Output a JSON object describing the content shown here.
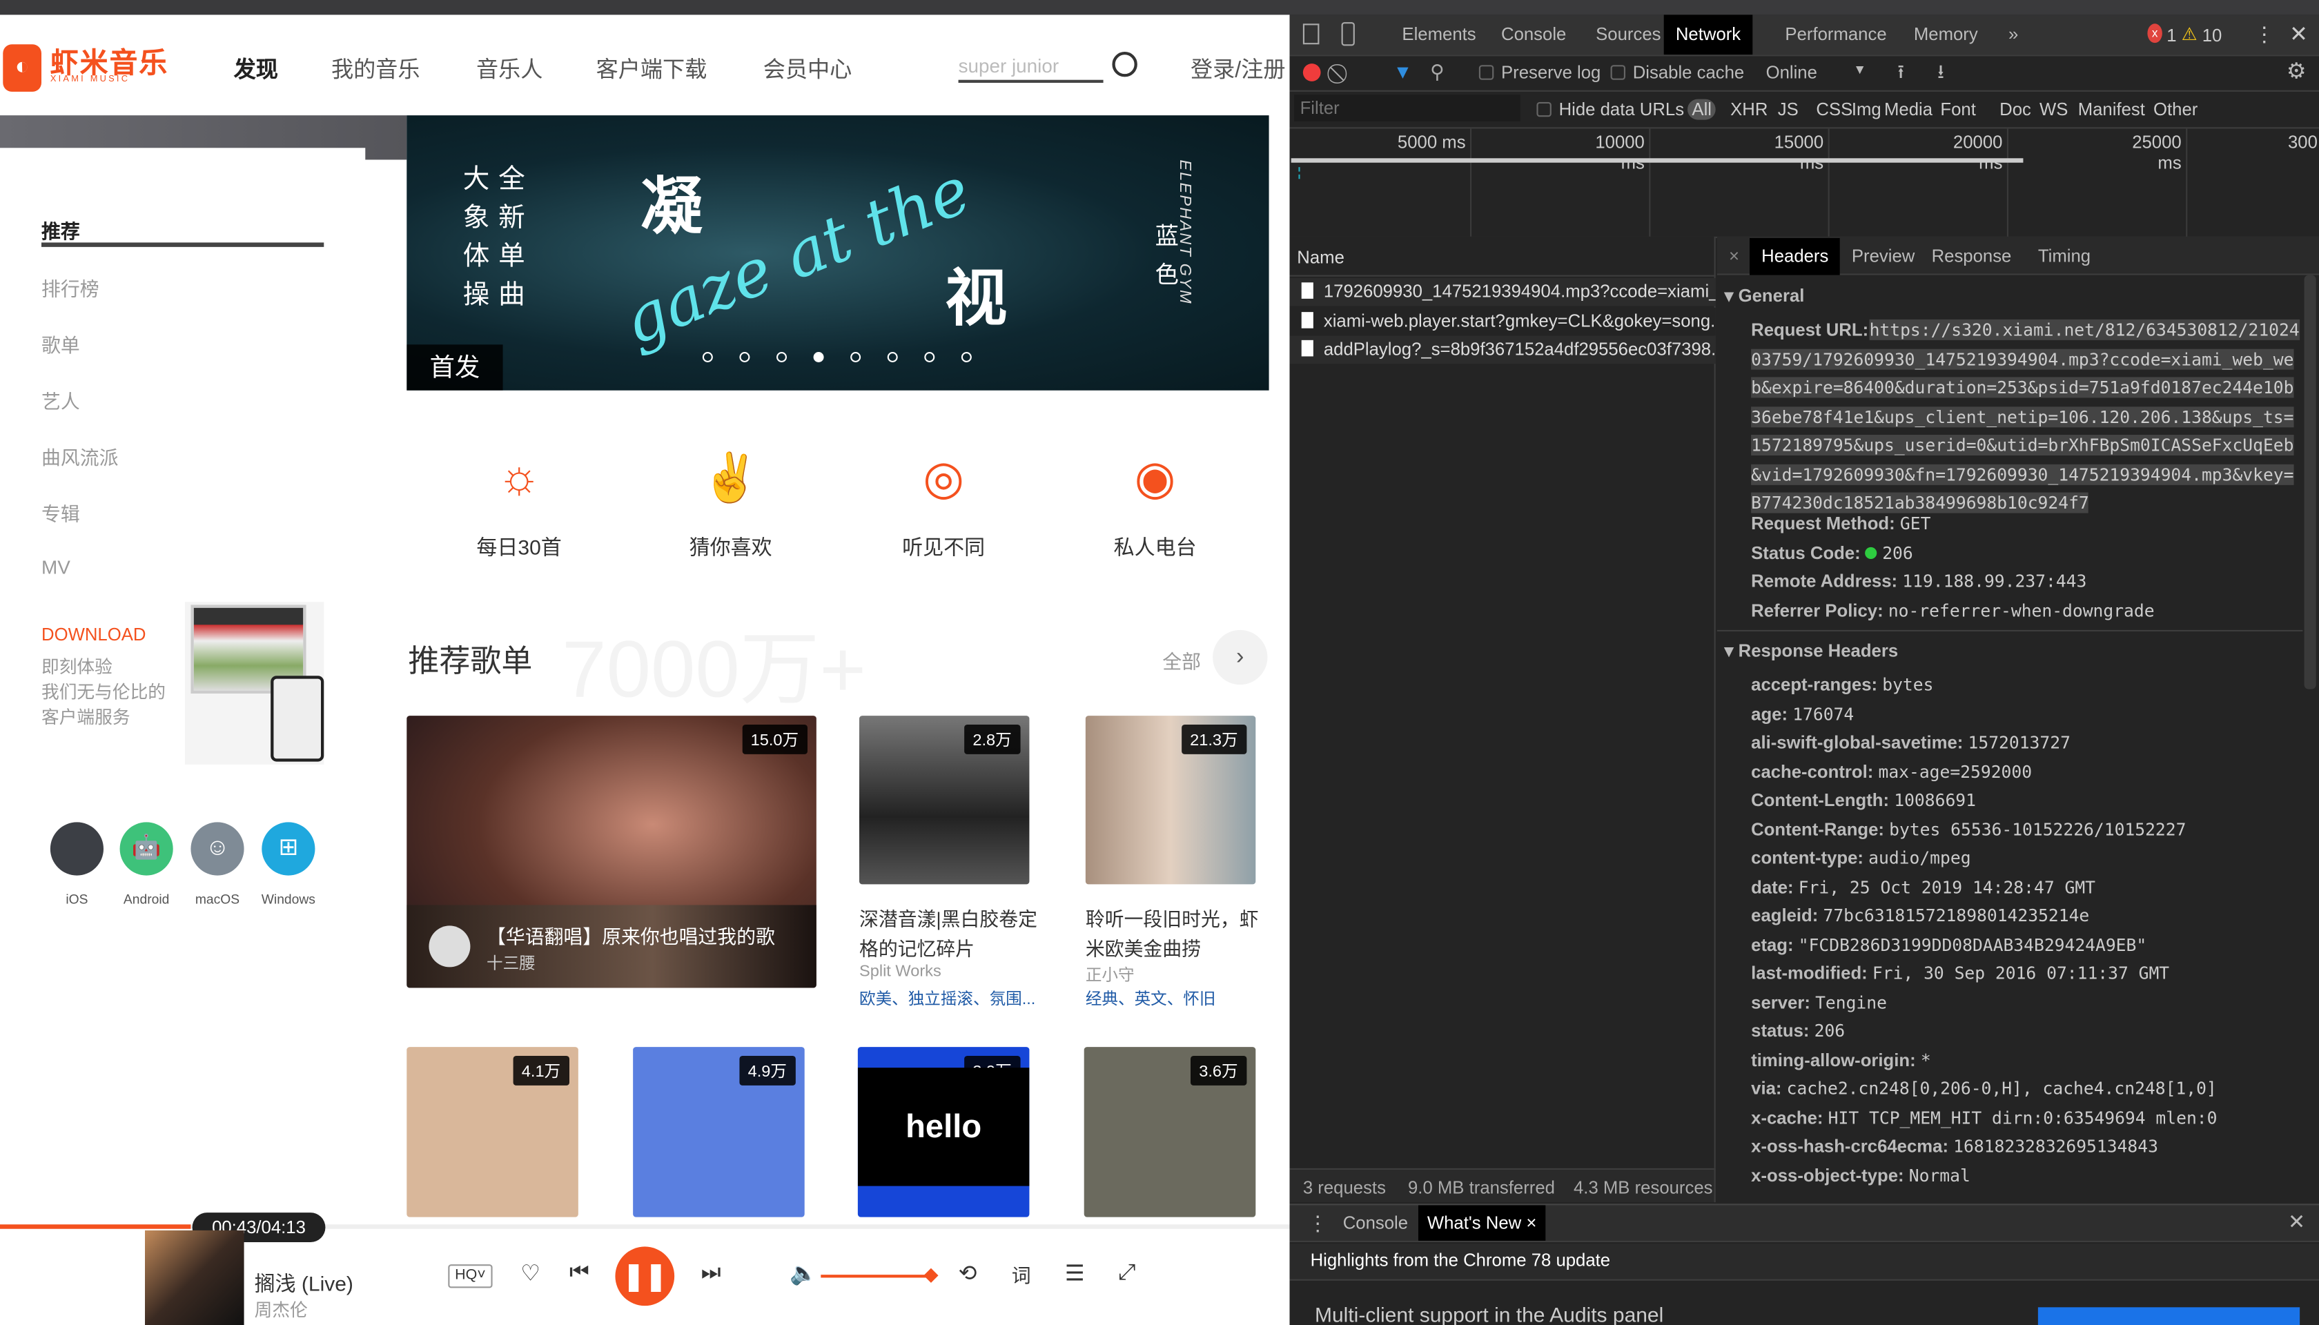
{
  "page": {
    "logo": {
      "title": "虾米音乐",
      "subtitle": "XIAMI MUSIC",
      "glyph": "◐"
    },
    "nav": [
      "发现",
      "我的音乐",
      "音乐人",
      "客户端下载",
      "会员中心"
    ],
    "search": {
      "value": "super junior"
    },
    "login": "登录/注册",
    "sidebar": {
      "items": [
        "推荐",
        "排行榜",
        "歌单",
        "艺人",
        "曲风流派",
        "专辑",
        "MV"
      ],
      "download_title": "DOWNLOAD",
      "download_lines": [
        "即刻体验",
        "我们无与伦比的",
        "客户端服务"
      ],
      "platforms": [
        {
          "label": "iOS",
          "color": "#3c3f45",
          "icon": ""
        },
        {
          "label": "Android",
          "color": "#3ec27a",
          "icon": "🤖"
        },
        {
          "label": "macOS",
          "color": "#7f8b96",
          "icon": "☺"
        },
        {
          "label": "Windows",
          "color": "#1fa8de",
          "icon": "⊞"
        }
      ]
    },
    "banner": {
      "vertical_left": "大象体操",
      "vertical_right": "全新单曲",
      "big1": "凝",
      "big2": "视",
      "script": "gaze at the",
      "side": "蓝色",
      "side_en": "ELEPHANT GYM",
      "tag": "首发",
      "slides": 8,
      "active_slide": 4
    },
    "features": [
      {
        "label": "每日30首",
        "icon": "sun-30-icon"
      },
      {
        "label": "猜你喜欢",
        "icon": "rock-hand-icon"
      },
      {
        "label": "听见不同",
        "icon": "planet-icon"
      },
      {
        "label": "私人电台",
        "icon": "radio-icon"
      }
    ],
    "playlists": {
      "title": "推荐歌单",
      "watermark": "7000万+",
      "all": "全部",
      "featured": {
        "plays": "15.0万",
        "title": "【华语翻唱】原来你也唱过我的歌",
        "author": "十三腰"
      },
      "row1": [
        {
          "plays": "2.8万",
          "title": "深潜音漾|黑白胶卷定格的记忆碎片",
          "author": "Split Works",
          "tags": "欧美、独立摇滚、氛围..."
        },
        {
          "plays": "21.3万",
          "title": "聆听一段旧时光，虾米欧美金曲捞",
          "author": "正小守",
          "tags": "经典、英文、怀旧"
        }
      ],
      "row2": [
        {
          "plays": "4.1万",
          "color": "#d9b79a"
        },
        {
          "plays": "4.9万",
          "color": "#5a7fe0"
        },
        {
          "plays": "3.9万",
          "color": "#1646d8",
          "art": "hello world"
        },
        {
          "plays": "3.6万",
          "color": "#6b6a5e"
        }
      ]
    },
    "player": {
      "time": "00:43/04:13",
      "progress": 0.17,
      "song": "搁浅 (Live)",
      "artist": "周杰伦",
      "quality": "HQ",
      "volume": 1.0,
      "lyrics": "词"
    }
  },
  "devtools": {
    "tabs": [
      "Elements",
      "Console",
      "Sources",
      "Network",
      "Performance",
      "Memory",
      "»"
    ],
    "active_tab": "Network",
    "errors": "1",
    "warnings": "10",
    "toolbar": {
      "preserve_log": "Preserve log",
      "disable_cache": "Disable cache",
      "throttle": "Online"
    },
    "filter": {
      "placeholder": "Filter",
      "hide_data_urls": "Hide data URLs",
      "types": [
        "All",
        "XHR",
        "JS",
        "CSS",
        "Img",
        "Media",
        "Font",
        "Doc",
        "WS",
        "Manifest",
        "Other"
      ]
    },
    "timeline": [
      "5000 ms",
      "10000 ms",
      "15000 ms",
      "20000 ms",
      "25000 ms",
      "300"
    ],
    "name_header": "Name",
    "requests": [
      "1792609930_1475219394904.mp3?ccode=xiami_...",
      "xiami-web.player.start?gmkey=CLK&gokey=song...",
      "addPlaylog?_s=8b9f367152a4df29556ec03f7398..."
    ],
    "detail_tabs": [
      "Headers",
      "Preview",
      "Response",
      "Timing"
    ],
    "general_title": "General",
    "request_url_label": "Request URL:",
    "request_url": "https://s320.xiami.net/812/634530812/2102403759/1792609930_1475219394904.mp3?ccode=xiami_web_web&expire=86400&duration=253&psid=751a9fd0187ec244e10b36ebe78f41e1&ups_client_netip=106.120.206.138&ups_ts=1572189795&ups_userid=0&utid=brXhFBpSm0ICASSeFxcUqEeb&vid=1792609930&fn=1792609930_1475219394904.mp3&vkey=B774230dc18521ab38499698b10c924f7",
    "general": [
      {
        "k": "Request Method:",
        "v": "GET"
      },
      {
        "k": "Status Code:",
        "v": "206",
        "dot": "#2ecc40"
      },
      {
        "k": "Remote Address:",
        "v": "119.188.99.237:443"
      },
      {
        "k": "Referrer Policy:",
        "v": "no-referrer-when-downgrade"
      }
    ],
    "response_title": "Response Headers",
    "response": [
      {
        "k": "accept-ranges:",
        "v": "bytes"
      },
      {
        "k": "age:",
        "v": "176074"
      },
      {
        "k": "ali-swift-global-savetime:",
        "v": "1572013727"
      },
      {
        "k": "cache-control:",
        "v": "max-age=2592000"
      },
      {
        "k": "Content-Length:",
        "v": "10086691"
      },
      {
        "k": "Content-Range:",
        "v": "bytes 65536-10152226/10152227"
      },
      {
        "k": "content-type:",
        "v": "audio/mpeg"
      },
      {
        "k": "date:",
        "v": "Fri, 25 Oct 2019 14:28:47 GMT"
      },
      {
        "k": "eagleid:",
        "v": "77bc631815721898014235214e"
      },
      {
        "k": "etag:",
        "v": "\"FCDB286D3199DD08DAAB34B29424A9EB\""
      },
      {
        "k": "last-modified:",
        "v": "Fri, 30 Sep 2016 07:11:37 GMT"
      },
      {
        "k": "server:",
        "v": "Tengine"
      },
      {
        "k": "status:",
        "v": "206"
      },
      {
        "k": "timing-allow-origin:",
        "v": "*"
      },
      {
        "k": "via:",
        "v": "cache2.cn248[0,206-0,H], cache4.cn248[1,0]"
      },
      {
        "k": "x-cache:",
        "v": "HIT TCP_MEM_HIT dirn:0:63549694 mlen:0"
      },
      {
        "k": "x-oss-hash-crc64ecma:",
        "v": "16818232832695134843"
      },
      {
        "k": "x-oss-object-type:",
        "v": "Normal"
      }
    ],
    "status_bar": [
      "3 requests",
      "9.0 MB transferred",
      "4.3 MB resources"
    ],
    "drawer": {
      "tabs": [
        "Console",
        "What's New"
      ],
      "active": "What's New",
      "highlight": "Highlights from the Chrome 78 update",
      "item": "Multi-client support in the Audits panel"
    }
  }
}
